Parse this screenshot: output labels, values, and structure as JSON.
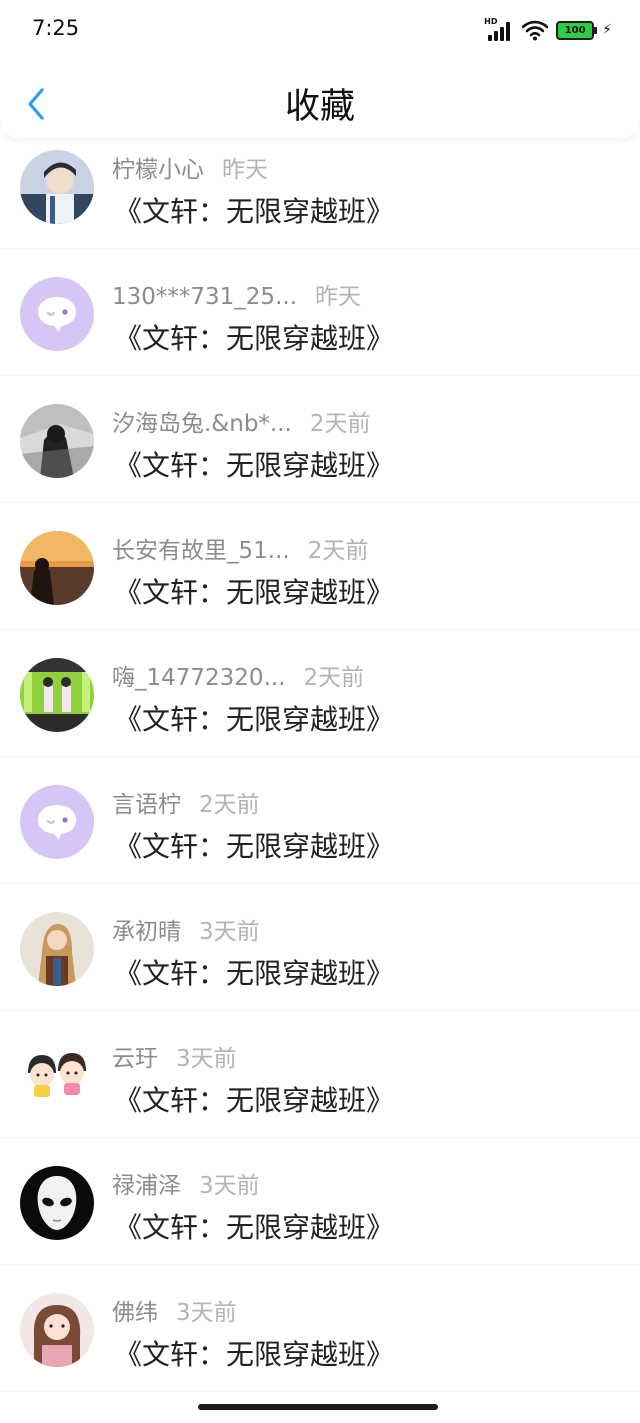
{
  "status_bar": {
    "time": "7:25",
    "signal_label": "HD",
    "battery": "100"
  },
  "header": {
    "title": "收藏",
    "back_icon": "chevron-left-icon",
    "accent_color": "#2a9df4"
  },
  "items": [
    {
      "user": "柠檬小心",
      "time": "昨天",
      "title": "《文轩：无限穿越班》",
      "avatar": "photo-boy-icon"
    },
    {
      "user": "130***731_25...",
      "time": "昨天",
      "title": "《文轩：无限穿越班》",
      "avatar": "chat-bubble-icon"
    },
    {
      "user": "汐海岛兔.&nb*...",
      "time": "2天前",
      "title": "《文轩：无限穿越班》",
      "avatar": "photo-dark-icon"
    },
    {
      "user": "长安有故里_51...",
      "time": "2天前",
      "title": "《文轩：无限穿越班》",
      "avatar": "photo-sunset-icon"
    },
    {
      "user": "嗨_14772320...",
      "time": "2天前",
      "title": "《文轩：无限穿越班》",
      "avatar": "photo-stage-icon"
    },
    {
      "user": "言语柠",
      "time": "2天前",
      "title": "《文轩：无限穿越班》",
      "avatar": "chat-bubble-icon"
    },
    {
      "user": "承初晴",
      "time": "3天前",
      "title": "《文轩：无限穿越班》",
      "avatar": "photo-woman-icon"
    },
    {
      "user": "云玗",
      "time": "3天前",
      "title": "《文轩：无限穿越班》",
      "avatar": "cartoon-kids-icon"
    },
    {
      "user": "禄浦泽",
      "time": "3天前",
      "title": "《文轩：无限穿越班》",
      "avatar": "mask-face-icon"
    },
    {
      "user": "佛纬",
      "time": "3天前",
      "title": "《文轩：无限穿越班》",
      "avatar": "photo-girl-icon"
    }
  ]
}
